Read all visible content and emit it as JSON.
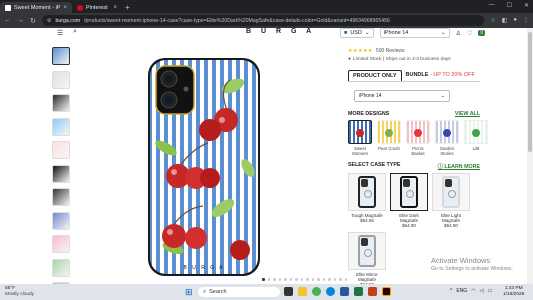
{
  "browser": {
    "tabs": [
      {
        "label": "Sweet Moment - iPhone 14 Ca...",
        "active": true,
        "favicon_color": "#ffffff"
      },
      {
        "label": "Pinterest",
        "active": false,
        "favicon_color": "#e60023"
      }
    ],
    "url_host": "burga.com",
    "url_path": "/products/sweet-moment-iphone-14-case?case-type=Elite%20Dark%20MagSafe&case-details-color=Gold&variant=49634968965456"
  },
  "site": {
    "logo": "B U R G A",
    "currency": "USD",
    "model_header": "iPhone 14",
    "cart_count": "0"
  },
  "product": {
    "rating_stars": "★★★★★",
    "reviews": "500 Reviews",
    "stock_note": "Limited Stock | Ships out in 2-3 business days",
    "tabs": {
      "product_only": "PRODUCT ONLY",
      "bundle": "BUNDLE",
      "bundle_promo": "- UP TO 20% OFF"
    },
    "model_select": "iPhone 14",
    "more_designs_label": "MORE DESIGNS",
    "view_all": "VIEW ALL",
    "designs": [
      {
        "name": "Sweet Moment",
        "colors": [
          "#3a6fb6",
          "#c62828"
        ]
      },
      {
        "name": "Pear Crush",
        "colors": [
          "#f4d35e",
          "#7cb342"
        ]
      },
      {
        "name": "Picnic Basket",
        "colors": [
          "#f3c1c6",
          "#e53935"
        ]
      },
      {
        "name": "Garden Stories",
        "colors": [
          "#c5cae9",
          "#3949ab"
        ]
      },
      {
        "name": "Littl",
        "colors": [
          "#e8f5e9",
          "#43a047"
        ]
      }
    ],
    "case_type_label": "SELECT CASE TYPE",
    "learn_more": "LEARN MORE",
    "cases": [
      {
        "name": "Tough MagSafe",
        "price": "$54.95",
        "frame": "#222222"
      },
      {
        "name": "Elite Dark MagSafe",
        "price": "$64.90",
        "frame": "#111111",
        "selected": true
      },
      {
        "name": "Elite Light MagSafe",
        "price": "$64.90",
        "frame": "#d9d9d9"
      },
      {
        "name": "Elite Mirror MagSafe",
        "price": "$84.90",
        "frame": "#9e9e9e"
      }
    ],
    "image_dots": 16,
    "active_dot": 0,
    "case_brand_text": "B U R G A"
  },
  "watermark": {
    "line1": "Activate Windows",
    "line2": "Go to Settings to activate Windows."
  },
  "taskbar": {
    "temp": "55°F",
    "condition": "Mostly cloudy",
    "search_placeholder": "Search",
    "tray_lang": "ENG",
    "time": "1:43 PM",
    "date": "1/16/2026"
  }
}
